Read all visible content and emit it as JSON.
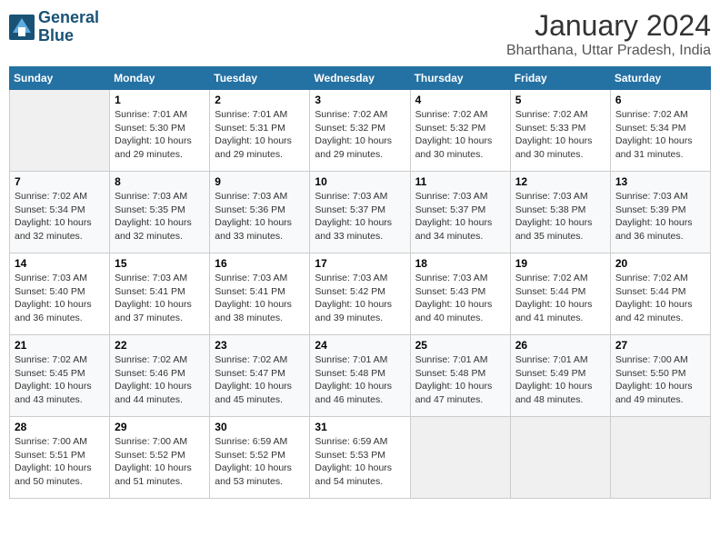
{
  "logo": {
    "line1": "General",
    "line2": "Blue"
  },
  "title": "January 2024",
  "subtitle": "Bharthana, Uttar Pradesh, India",
  "days_of_week": [
    "Sunday",
    "Monday",
    "Tuesday",
    "Wednesday",
    "Thursday",
    "Friday",
    "Saturday"
  ],
  "weeks": [
    [
      {
        "day": "",
        "info": ""
      },
      {
        "day": "1",
        "info": "Sunrise: 7:01 AM\nSunset: 5:30 PM\nDaylight: 10 hours\nand 29 minutes."
      },
      {
        "day": "2",
        "info": "Sunrise: 7:01 AM\nSunset: 5:31 PM\nDaylight: 10 hours\nand 29 minutes."
      },
      {
        "day": "3",
        "info": "Sunrise: 7:02 AM\nSunset: 5:32 PM\nDaylight: 10 hours\nand 29 minutes."
      },
      {
        "day": "4",
        "info": "Sunrise: 7:02 AM\nSunset: 5:32 PM\nDaylight: 10 hours\nand 30 minutes."
      },
      {
        "day": "5",
        "info": "Sunrise: 7:02 AM\nSunset: 5:33 PM\nDaylight: 10 hours\nand 30 minutes."
      },
      {
        "day": "6",
        "info": "Sunrise: 7:02 AM\nSunset: 5:34 PM\nDaylight: 10 hours\nand 31 minutes."
      }
    ],
    [
      {
        "day": "7",
        "info": "Sunrise: 7:02 AM\nSunset: 5:34 PM\nDaylight: 10 hours\nand 32 minutes."
      },
      {
        "day": "8",
        "info": "Sunrise: 7:03 AM\nSunset: 5:35 PM\nDaylight: 10 hours\nand 32 minutes."
      },
      {
        "day": "9",
        "info": "Sunrise: 7:03 AM\nSunset: 5:36 PM\nDaylight: 10 hours\nand 33 minutes."
      },
      {
        "day": "10",
        "info": "Sunrise: 7:03 AM\nSunset: 5:37 PM\nDaylight: 10 hours\nand 33 minutes."
      },
      {
        "day": "11",
        "info": "Sunrise: 7:03 AM\nSunset: 5:37 PM\nDaylight: 10 hours\nand 34 minutes."
      },
      {
        "day": "12",
        "info": "Sunrise: 7:03 AM\nSunset: 5:38 PM\nDaylight: 10 hours\nand 35 minutes."
      },
      {
        "day": "13",
        "info": "Sunrise: 7:03 AM\nSunset: 5:39 PM\nDaylight: 10 hours\nand 36 minutes."
      }
    ],
    [
      {
        "day": "14",
        "info": "Sunrise: 7:03 AM\nSunset: 5:40 PM\nDaylight: 10 hours\nand 36 minutes."
      },
      {
        "day": "15",
        "info": "Sunrise: 7:03 AM\nSunset: 5:41 PM\nDaylight: 10 hours\nand 37 minutes."
      },
      {
        "day": "16",
        "info": "Sunrise: 7:03 AM\nSunset: 5:41 PM\nDaylight: 10 hours\nand 38 minutes."
      },
      {
        "day": "17",
        "info": "Sunrise: 7:03 AM\nSunset: 5:42 PM\nDaylight: 10 hours\nand 39 minutes."
      },
      {
        "day": "18",
        "info": "Sunrise: 7:03 AM\nSunset: 5:43 PM\nDaylight: 10 hours\nand 40 minutes."
      },
      {
        "day": "19",
        "info": "Sunrise: 7:02 AM\nSunset: 5:44 PM\nDaylight: 10 hours\nand 41 minutes."
      },
      {
        "day": "20",
        "info": "Sunrise: 7:02 AM\nSunset: 5:44 PM\nDaylight: 10 hours\nand 42 minutes."
      }
    ],
    [
      {
        "day": "21",
        "info": "Sunrise: 7:02 AM\nSunset: 5:45 PM\nDaylight: 10 hours\nand 43 minutes."
      },
      {
        "day": "22",
        "info": "Sunrise: 7:02 AM\nSunset: 5:46 PM\nDaylight: 10 hours\nand 44 minutes."
      },
      {
        "day": "23",
        "info": "Sunrise: 7:02 AM\nSunset: 5:47 PM\nDaylight: 10 hours\nand 45 minutes."
      },
      {
        "day": "24",
        "info": "Sunrise: 7:01 AM\nSunset: 5:48 PM\nDaylight: 10 hours\nand 46 minutes."
      },
      {
        "day": "25",
        "info": "Sunrise: 7:01 AM\nSunset: 5:48 PM\nDaylight: 10 hours\nand 47 minutes."
      },
      {
        "day": "26",
        "info": "Sunrise: 7:01 AM\nSunset: 5:49 PM\nDaylight: 10 hours\nand 48 minutes."
      },
      {
        "day": "27",
        "info": "Sunrise: 7:00 AM\nSunset: 5:50 PM\nDaylight: 10 hours\nand 49 minutes."
      }
    ],
    [
      {
        "day": "28",
        "info": "Sunrise: 7:00 AM\nSunset: 5:51 PM\nDaylight: 10 hours\nand 50 minutes."
      },
      {
        "day": "29",
        "info": "Sunrise: 7:00 AM\nSunset: 5:52 PM\nDaylight: 10 hours\nand 51 minutes."
      },
      {
        "day": "30",
        "info": "Sunrise: 6:59 AM\nSunset: 5:52 PM\nDaylight: 10 hours\nand 53 minutes."
      },
      {
        "day": "31",
        "info": "Sunrise: 6:59 AM\nSunset: 5:53 PM\nDaylight: 10 hours\nand 54 minutes."
      },
      {
        "day": "",
        "info": ""
      },
      {
        "day": "",
        "info": ""
      },
      {
        "day": "",
        "info": ""
      }
    ]
  ]
}
